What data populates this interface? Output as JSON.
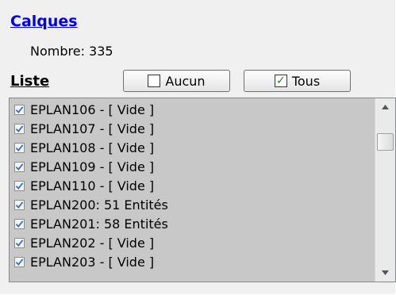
{
  "header": {
    "title": "Calques",
    "count_label": "Nombre: 335"
  },
  "list": {
    "heading": "Liste",
    "buttons": {
      "none_label": "Aucun",
      "all_label": "Tous"
    },
    "items": [
      {
        "label": "EPLAN106 - [ Vide ]",
        "checked": true
      },
      {
        "label": "EPLAN107 - [ Vide ]",
        "checked": true
      },
      {
        "label": "EPLAN108 - [ Vide ]",
        "checked": true
      },
      {
        "label": "EPLAN109 - [ Vide ]",
        "checked": true
      },
      {
        "label": "EPLAN110 - [ Vide ]",
        "checked": true
      },
      {
        "label": "EPLAN200: 51 Entités",
        "checked": true
      },
      {
        "label": "EPLAN201: 58 Entités",
        "checked": true
      },
      {
        "label": "EPLAN202 - [ Vide ]",
        "checked": true
      },
      {
        "label": "EPLAN203 - [ Vide ]",
        "checked": true
      }
    ]
  },
  "colors": {
    "link": "#0000ee",
    "check_mark": "#3b6fc4",
    "list_background": "#c8c8c8"
  },
  "icons": {
    "none_button_icon": "empty-checkbox-icon",
    "all_button_icon": "checked-checkbox-icon",
    "item_icon": "checkbox-checked-icon",
    "scroll_up": "arrow-up-icon",
    "scroll_down": "arrow-down-icon"
  }
}
